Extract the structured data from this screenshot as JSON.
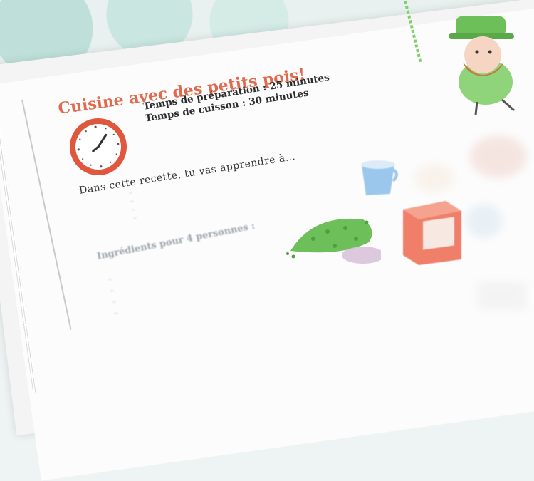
{
  "recipe": {
    "title": "Cuisine avec des petits pois!",
    "prep_time": "Temps de préparation : 25 minutes",
    "cook_time": "Temps de cuisson : 30 minutes",
    "intro": "Dans cette recette, tu vas apprendre à…",
    "ingredients_title": "Ingrédients pour 4 personnes :"
  },
  "colors": {
    "title": "#e06a4e",
    "clock_ring": "#e0573d",
    "pea_green": "#6dbf5a",
    "cup_blue": "#7fb6e6",
    "box_red": "#ef7f68"
  },
  "icons": [
    "clock-icon",
    "leprechaun-illustration",
    "cup-illustration",
    "peas-illustration",
    "sugar-box-illustration"
  ]
}
